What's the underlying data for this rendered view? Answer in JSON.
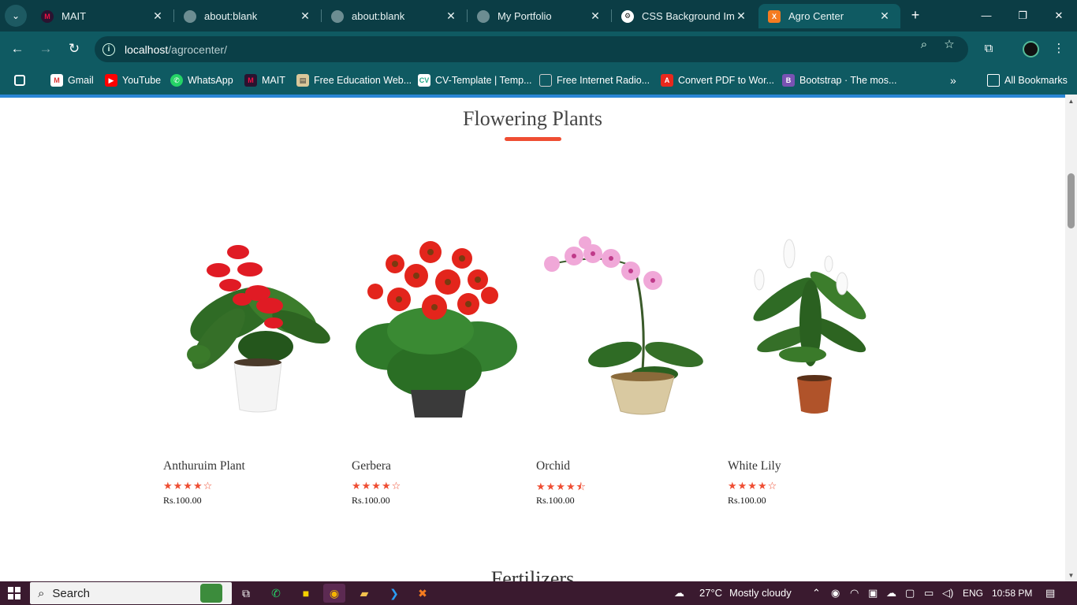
{
  "tabs": [
    {
      "title": "MAIT",
      "icon": "mait-logo-icon",
      "active": false
    },
    {
      "title": "about:blank",
      "icon": "globe-icon",
      "active": false
    },
    {
      "title": "about:blank",
      "icon": "globe-icon",
      "active": false
    },
    {
      "title": "My Portfolio",
      "icon": "globe-icon",
      "active": false
    },
    {
      "title": "CSS Background Imag",
      "icon": "openai-icon",
      "active": false
    },
    {
      "title": "Agro Center",
      "icon": "xampp-icon",
      "active": true
    }
  ],
  "address_bar": {
    "host": "localhost",
    "path": "/agrocenter/"
  },
  "bookmarks": [
    {
      "label": "Gmail",
      "icon": "gmail-icon"
    },
    {
      "label": "YouTube",
      "icon": "youtube-icon"
    },
    {
      "label": "WhatsApp",
      "icon": "whatsapp-icon"
    },
    {
      "label": "MAIT",
      "icon": "mait-logo-icon"
    },
    {
      "label": "Free Education Web...",
      "icon": "education-icon"
    },
    {
      "label": "CV-Template | Temp...",
      "icon": "cv-icon"
    },
    {
      "label": "Free Internet Radio...",
      "icon": "radio-icon"
    },
    {
      "label": "Convert PDF to Wor...",
      "icon": "pdf-icon"
    },
    {
      "label": "Bootstrap · The mos...",
      "icon": "bootstrap-icon"
    }
  ],
  "all_bookmarks_label": "All Bookmarks",
  "section": {
    "title": "Flowering Plants",
    "products": [
      {
        "name": "Anthuruim Plant",
        "rating": 4,
        "stars": "★★★★☆",
        "price": "Rs.100.00"
      },
      {
        "name": "Gerbera",
        "rating": 4,
        "stars": "★★★★☆",
        "price": "Rs.100.00"
      },
      {
        "name": "Orchid",
        "rating": 4.5,
        "stars": "★★★★⯪",
        "price": "Rs.100.00"
      },
      {
        "name": "White Lily",
        "rating": 4,
        "stars": "★★★★☆",
        "price": "Rs.100.00"
      }
    ]
  },
  "next_section_title": "Fertilizers",
  "taskbar": {
    "search_placeholder": "Search",
    "weather": "27°C",
    "weather_text": "Mostly cloudy",
    "language": "ENG",
    "time": "10:58 PM"
  },
  "colors": {
    "accent": "#ef4e33",
    "browser_chrome": "#0f5a62",
    "taskbar": "#3a1a2f"
  }
}
